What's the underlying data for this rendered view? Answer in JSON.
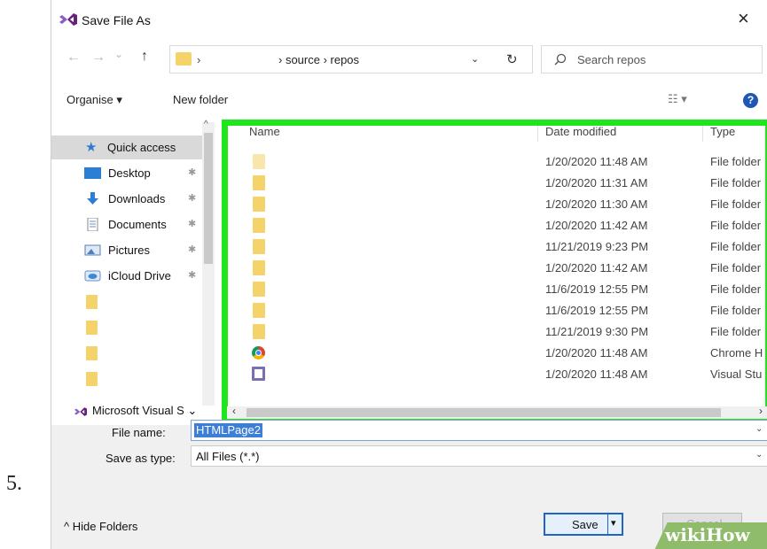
{
  "step_number": "5.",
  "window": {
    "title": "Save File As",
    "close_glyph": "×"
  },
  "nav": {
    "back": "←",
    "forward": "→",
    "recent": "⌄",
    "up": "↑",
    "path_sep0": "›",
    "path_text": "› source › repos",
    "address_dropdown": "⌄",
    "refresh": "↻",
    "search_placeholder": "Search repos"
  },
  "toolbar": {
    "organise": "Organise ▾",
    "new_folder": "New folder",
    "view": "☷ ▾",
    "help": "?"
  },
  "sidebar": {
    "quick_access": "Quick access",
    "items": [
      {
        "label": "Desktop",
        "icon": "desktop-icon"
      },
      {
        "label": "Downloads",
        "icon": "download-icon"
      },
      {
        "label": "Documents",
        "icon": "documents-icon"
      },
      {
        "label": "Pictures",
        "icon": "pictures-icon"
      },
      {
        "label": "iCloud Drive",
        "icon": "cloud-icon"
      }
    ],
    "pin_glyph": "✱",
    "ms_visual": "Microsoft Visual S",
    "ms_visual_chev": "⌄"
  },
  "columns": {
    "name": "Name",
    "date": "Date modified",
    "type": "Type"
  },
  "files": [
    {
      "icon": "folder-icon",
      "date": "1/20/2020 11:48 AM",
      "type": "File folder"
    },
    {
      "icon": "folder-icon",
      "date": "1/20/2020 11:31 AM",
      "type": "File folder"
    },
    {
      "icon": "folder-icon",
      "date": "1/20/2020 11:30 AM",
      "type": "File folder"
    },
    {
      "icon": "folder-icon",
      "date": "1/20/2020 11:42 AM",
      "type": "File folder"
    },
    {
      "icon": "folder-icon",
      "date": "11/21/2019 9:23 PM",
      "type": "File folder"
    },
    {
      "icon": "folder-icon",
      "date": "1/20/2020 11:42 AM",
      "type": "File folder"
    },
    {
      "icon": "folder-icon",
      "date": "11/6/2019 12:55 PM",
      "type": "File folder"
    },
    {
      "icon": "folder-icon",
      "date": "11/6/2019 12:55 PM",
      "type": "File folder"
    },
    {
      "icon": "folder-icon",
      "date": "11/21/2019 9:30 PM",
      "type": "File folder"
    },
    {
      "icon": "chrome-icon",
      "date": "1/20/2020 11:48 AM",
      "type": "Chrome H"
    },
    {
      "icon": "visual-studio-icon",
      "date": "1/20/2020 11:48 AM",
      "type": "Visual Stu"
    }
  ],
  "scroll": {
    "left": "‹",
    "right": "›",
    "up": "^"
  },
  "form": {
    "file_name_label": "File name:",
    "file_name_value": "HTMLPage2",
    "save_type_label": "Save as type:",
    "save_type_value": "All Files (*.*)",
    "dropdown": "⌄"
  },
  "footer": {
    "hide_folders": "^ Hide Folders",
    "save": "Save",
    "save_split": "▾",
    "cancel": "Cancel"
  },
  "watermark": {
    "wiki": "wiki",
    "how": "How"
  },
  "colors": {
    "highlight": "#1ee51e",
    "selection": "#3d7fd6",
    "folder": "#f3d36a",
    "accent": "#1c66c9"
  }
}
